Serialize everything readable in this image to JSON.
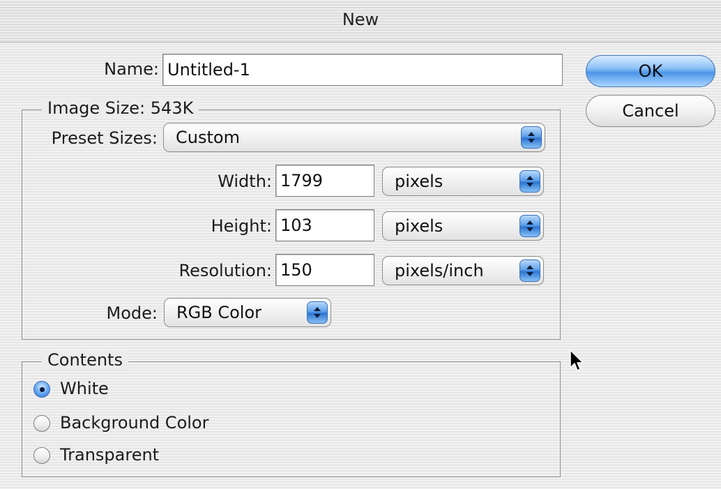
{
  "dialog": {
    "title": "New",
    "ok_label": "OK",
    "cancel_label": "Cancel"
  },
  "name": {
    "label": "Name:",
    "value": "Untitled-1"
  },
  "image_size": {
    "legend": "Image Size: 543K",
    "preset_label": "Preset Sizes:",
    "preset_value": "Custom",
    "width_label": "Width:",
    "width_value": "1799",
    "width_unit": "pixels",
    "height_label": "Height:",
    "height_value": "103",
    "height_unit": "pixels",
    "resolution_label": "Resolution:",
    "resolution_value": "150",
    "resolution_unit": "pixels/inch",
    "mode_label": "Mode:",
    "mode_value": "RGB Color"
  },
  "contents": {
    "legend": "Contents",
    "options": [
      {
        "label": "White",
        "selected": true
      },
      {
        "label": "Background Color",
        "selected": false
      },
      {
        "label": "Transparent",
        "selected": false
      }
    ]
  },
  "icons": {
    "stepper": "up-down-arrows-icon",
    "cursor": "mouse-pointer-icon"
  },
  "colors": {
    "accent": "#4d95e8",
    "background": "#ececec"
  }
}
